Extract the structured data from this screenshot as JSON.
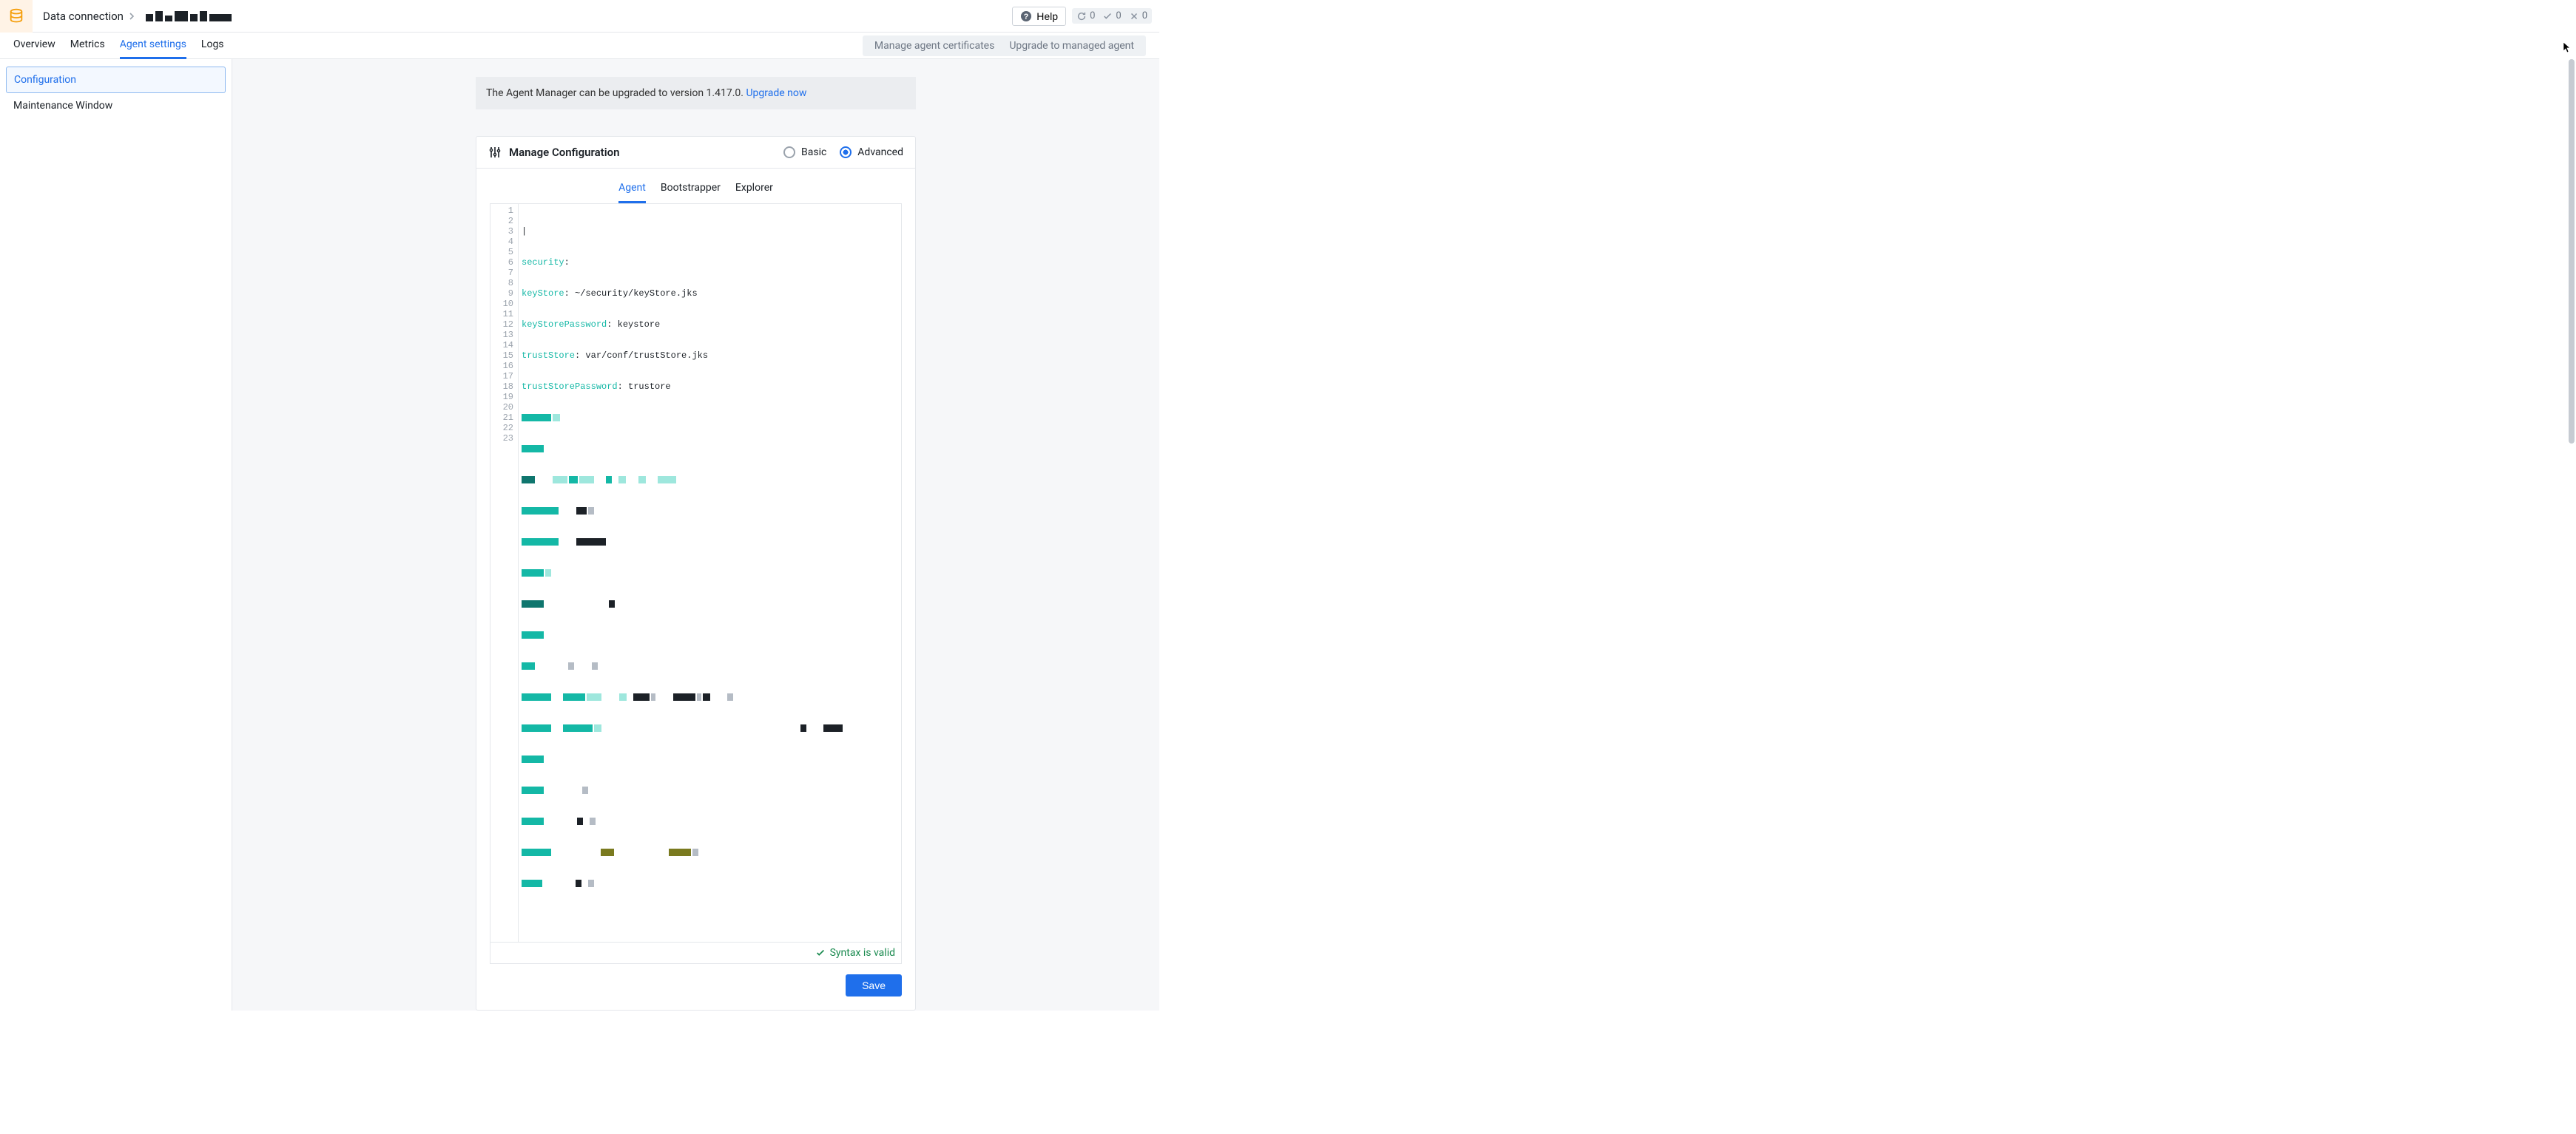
{
  "header": {
    "breadcrumb_label": "Data connection",
    "help_label": "Help",
    "status": {
      "refresh": "0",
      "success": "0",
      "fail": "0"
    }
  },
  "tabs": {
    "overview": "Overview",
    "metrics": "Metrics",
    "agent_settings": "Agent settings",
    "logs": "Logs",
    "manage_certs": "Manage agent certificates",
    "upgrade_managed": "Upgrade to managed agent"
  },
  "sidebar": {
    "configuration": "Configuration",
    "maintenance": "Maintenance Window"
  },
  "banner": {
    "text": "The Agent Manager can be upgraded to version 1.417.0. ",
    "link": "Upgrade now"
  },
  "card": {
    "title": "Manage Configuration",
    "mode_basic": "Basic",
    "mode_advanced": "Advanced",
    "inner_tabs": {
      "agent": "Agent",
      "bootstrapper": "Bootstrapper",
      "explorer": "Explorer"
    },
    "syntax_valid": "Syntax is valid",
    "save": "Save"
  },
  "editor": {
    "line_count": 23,
    "code": {
      "l2_key": "security",
      "l2_colon": ":",
      "l3_key": "keyStore",
      "l3_val": ": ~/security/keyStore.jks",
      "l4_key": "keyStorePassword",
      "l4_val": ": keystore",
      "l5_key": "trustStore",
      "l5_val": ": var/conf/trustStore.jks",
      "l6_key": "trustStorePassword",
      "l6_val": ": trustore"
    }
  }
}
